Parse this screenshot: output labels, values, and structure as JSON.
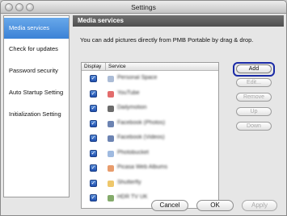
{
  "window": {
    "title": "Settings"
  },
  "sidebar": {
    "items": [
      {
        "label": "Media services",
        "active": true
      },
      {
        "label": "Check for updates",
        "active": false
      },
      {
        "label": "Password security",
        "active": false
      },
      {
        "label": "Auto Startup Setting",
        "active": false
      },
      {
        "label": "Initialization Setting",
        "active": false
      }
    ]
  },
  "main": {
    "header": "Media services",
    "description": "You can add pictures directly from PMB Portable by drag & drop.",
    "list": {
      "columns": {
        "display": "Display",
        "service": "Service"
      },
      "rows": [
        {
          "label": "Personal Space",
          "checked": true,
          "icon_color": "#8fa6c8"
        },
        {
          "label": "YouTube",
          "checked": true,
          "icon_color": "#d93b3b"
        },
        {
          "label": "Dailymotion",
          "checked": true,
          "icon_color": "#3a3a3a"
        },
        {
          "label": "Facebook (Photos)",
          "checked": true,
          "icon_color": "#3b5998"
        },
        {
          "label": "Facebook (Videos)",
          "checked": true,
          "icon_color": "#3b5998"
        },
        {
          "label": "Photobucket",
          "checked": true,
          "icon_color": "#7fa3d6"
        },
        {
          "label": "Picasa Web Albums",
          "checked": true,
          "icon_color": "#e07b3b"
        },
        {
          "label": "Shutterfly",
          "checked": true,
          "icon_color": "#e8b43a"
        },
        {
          "label": "HDR TV UK",
          "checked": true,
          "icon_color": "#5b8f3a"
        }
      ]
    },
    "buttons": {
      "add": "Add",
      "edit": "Edit...",
      "remove": "Remove",
      "up": "Up",
      "down": "Down"
    }
  },
  "footer": {
    "cancel": "Cancel",
    "ok": "OK",
    "apply": "Apply"
  }
}
